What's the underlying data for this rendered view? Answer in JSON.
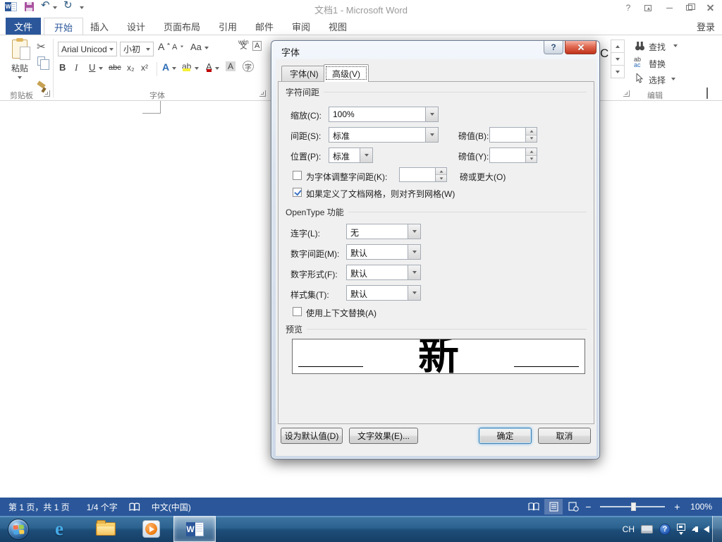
{
  "title_bar": {
    "title": "文档1 - Microsoft Word",
    "undo_glyph": "↶",
    "redo_glyph": "↻",
    "help_glyph": "?"
  },
  "ribbon": {
    "file_tab": "文件",
    "tabs": [
      "开始",
      "插入",
      "设计",
      "页面布局",
      "引用",
      "邮件",
      "审阅",
      "视图"
    ],
    "sign_in": "登录",
    "clipboard_group": {
      "paste": "粘贴",
      "label": "剪贴板",
      "scissors_glyph": "✂"
    },
    "font_group": {
      "font_name": "Arial Unicod",
      "font_size": "小初",
      "label": "字体",
      "bold": "B",
      "italic": "I",
      "underline": "U",
      "strikethrough": "abc",
      "subscript": "x₂",
      "superscript": "x²",
      "grow_font": "A",
      "shrink_font": "A",
      "change_case": "Aa",
      "clear_formatting": "A",
      "pinyin_top": "wén",
      "pinyin_bottom": "文",
      "char_border": "A",
      "text_effects": "A",
      "highlight": "ab",
      "font_color": "A",
      "char_shading": "A",
      "enclose": "字"
    },
    "styles_group": {
      "partial_style": "C"
    },
    "editing_group": {
      "find": "查找",
      "replace": "替换",
      "select": "选择",
      "label": "编辑",
      "replace_icon_top": "ab",
      "replace_icon_bottom": "ac"
    }
  },
  "dialog": {
    "title": "字体",
    "help_glyph": "?",
    "tab_font": "字体(N)",
    "tab_advanced": "高级(V)",
    "char_spacing": {
      "section": "字符间距",
      "scale_label": "缩放(C):",
      "scale_value": "100%",
      "spacing_label": "间距(S):",
      "spacing_value": "标准",
      "by_b_label": "磅值(B):",
      "by_b_value": "",
      "position_label": "位置(P):",
      "position_value": "标准",
      "by_y_label": "磅值(Y):",
      "by_y_value": "",
      "kerning_label": "为字体调整字间距(K):",
      "kerning_value": "",
      "kerning_suffix": "磅或更大(O)",
      "grid_label": "如果定义了文档网格，则对齐到网格(W)"
    },
    "opentype": {
      "section": "OpenType 功能",
      "ligatures_label": "连字(L):",
      "ligatures_value": "无",
      "number_spacing_label": "数字间距(M):",
      "number_spacing_value": "默认",
      "number_forms_label": "数字形式(F):",
      "number_forms_value": "默认",
      "stylistic_label": "样式集(T):",
      "stylistic_value": "默认",
      "contextual_label": "使用上下文替换(A)"
    },
    "preview": {
      "section": "预览",
      "sample_char": "新"
    },
    "buttons": {
      "set_default": "设为默认值(D)",
      "text_effects": "文字效果(E)...",
      "ok": "确定",
      "cancel": "取消"
    }
  },
  "status_bar": {
    "page_info": "第 1 页，共 1 页",
    "word_count": "1/4 个字",
    "language": "中文(中国)",
    "zoom_minus": "−",
    "zoom_plus": "+",
    "zoom_level": "100%"
  },
  "taskbar": {
    "word_logo": "W",
    "tray_language": "CH",
    "help_glyph": "?"
  },
  "colors": {
    "word_blue": "#2b579a",
    "close_red": "#c0331c",
    "highlight_yellow": "#f7ef37",
    "font_color_red": "#c00000"
  }
}
